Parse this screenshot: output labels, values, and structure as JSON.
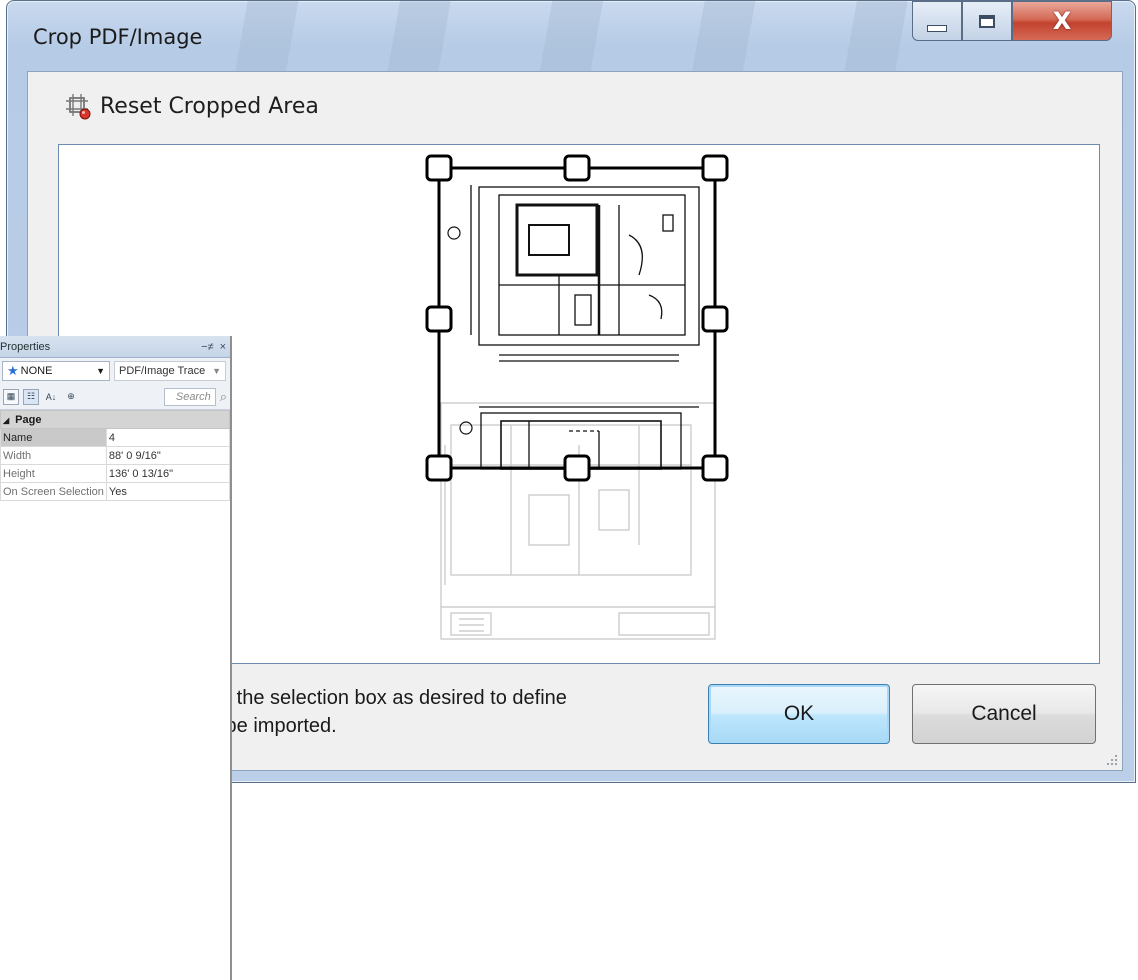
{
  "window": {
    "title": "Crop PDF/Image",
    "controls": {
      "minimize_icon": "minimize-icon",
      "maximize_icon": "maximize-icon",
      "close_label": "X"
    }
  },
  "toolbar": {
    "reset_label": "Reset Cropped Area",
    "reset_icon": "crop-reset-icon"
  },
  "instructions": {
    "line1": "e the selection box as desired to define",
    "line2": " be imported."
  },
  "buttons": {
    "ok": "OK",
    "cancel": "Cancel"
  },
  "properties": {
    "title": "Properties",
    "pin_icon": "−≠",
    "close_icon": "×",
    "style_dropdown": "NONE",
    "type_dropdown": "PDF/Image Trace",
    "search_placeholder": "Search",
    "category": "Page",
    "rows": [
      {
        "name": "Name",
        "value": "4"
      },
      {
        "name": "Width",
        "value": "88' 0 9/16\""
      },
      {
        "name": "Height",
        "value": "136' 0 13/16\""
      },
      {
        "name": "On Screen Selection",
        "value": "Yes"
      }
    ]
  },
  "colors": {
    "titlebar": "#bccfe8",
    "close_button": "#c2432f",
    "ok_button": "#bee6fd",
    "canvas_border": "#6b8cb0"
  }
}
